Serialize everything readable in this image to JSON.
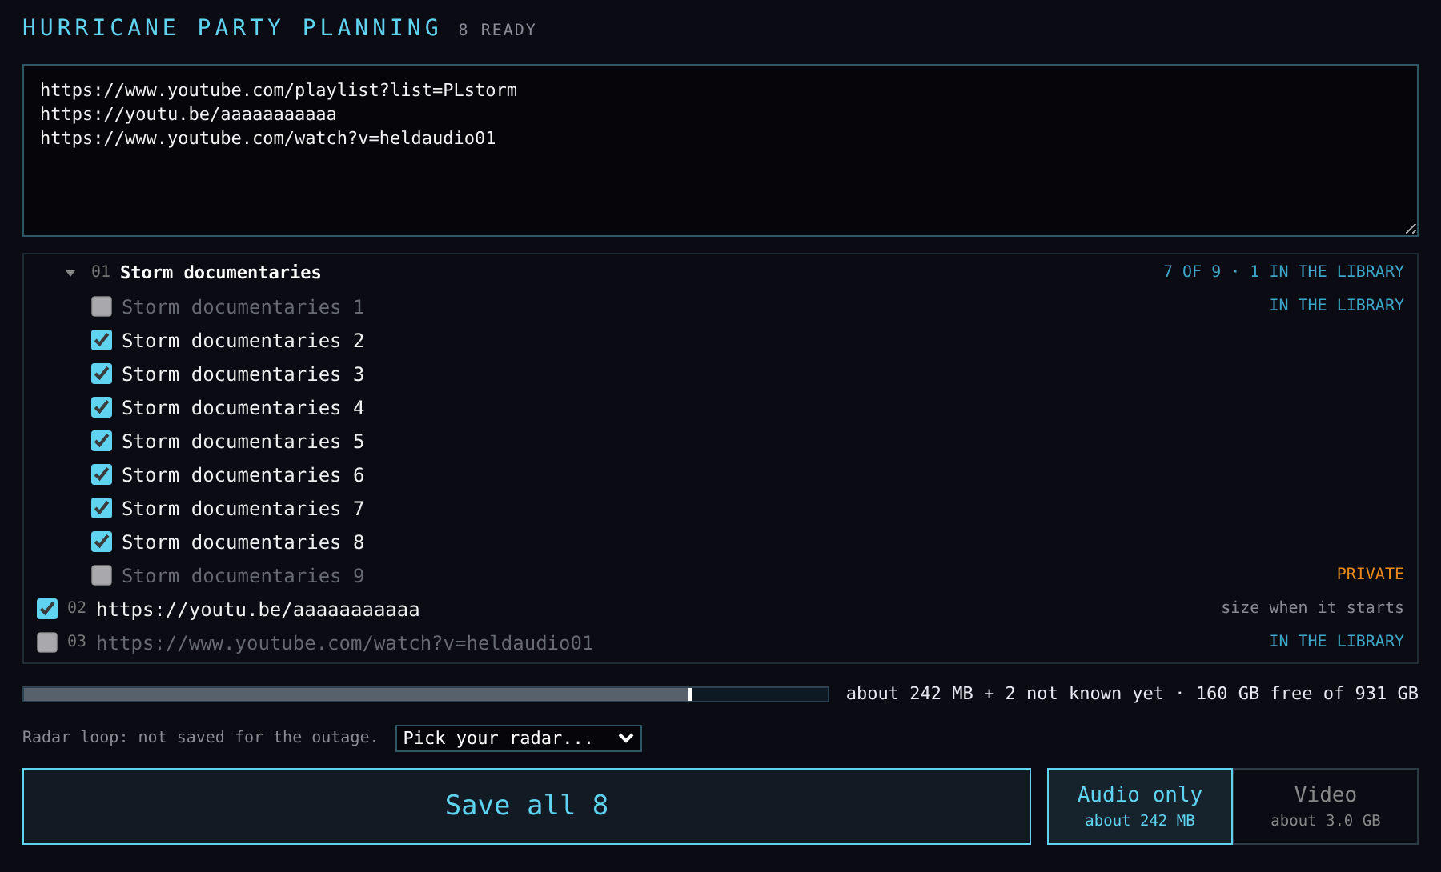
{
  "header": {
    "title": "HURRICANE PARTY PLANNING",
    "count": "8 READY"
  },
  "links_box": {
    "value": "https://www.youtube.com/playlist?list=PLstorm\nhttps://youtu.be/aaaaaaaaaaa\nhttps://www.youtube.com/watch?v=heldaudio01"
  },
  "items": [
    {
      "kind": "playlist",
      "number": "01",
      "title": "Storm documentaries",
      "expanded": true,
      "note": {
        "text": "7 OF 9 · 1 IN THE LIBRARY",
        "color": "#3fa6c9"
      },
      "children": [
        {
          "title": "Storm documentaries 1",
          "checked": false,
          "disabled": true,
          "note": {
            "text": "IN THE LIBRARY",
            "color": "#3fa6c9"
          }
        },
        {
          "title": "Storm documentaries 2",
          "checked": true,
          "disabled": false
        },
        {
          "title": "Storm documentaries 3",
          "checked": true,
          "disabled": false
        },
        {
          "title": "Storm documentaries 4",
          "checked": true,
          "disabled": false
        },
        {
          "title": "Storm documentaries 5",
          "checked": true,
          "disabled": false
        },
        {
          "title": "Storm documentaries 6",
          "checked": true,
          "disabled": false
        },
        {
          "title": "Storm documentaries 7",
          "checked": true,
          "disabled": false
        },
        {
          "title": "Storm documentaries 8",
          "checked": true,
          "disabled": false
        },
        {
          "title": "Storm documentaries 9",
          "checked": false,
          "disabled": true,
          "note": {
            "text": "PRIVATE",
            "color": "#e8881a"
          }
        }
      ]
    },
    {
      "kind": "video",
      "number": "02",
      "title": "https://youtu.be/aaaaaaaaaaa",
      "checked": true,
      "disabled": false,
      "note": {
        "text": "size when it starts",
        "color": "#8a8a92"
      }
    },
    {
      "kind": "video",
      "number": "03",
      "title": "https://www.youtube.com/watch?v=heldaudio01",
      "checked": false,
      "disabled": true,
      "note": {
        "text": "IN THE LIBRARY",
        "color": "#3fa6c9"
      }
    }
  ],
  "storage": {
    "level": 0.83,
    "reading": "about 242 MB + 2 not known yet · 160 GB free of 931 GB"
  },
  "radar": {
    "label": "Radar loop: not saved for the outage.",
    "placeholder": "Pick your radar..."
  },
  "save_button": "Save all 8",
  "formats": [
    {
      "label": "Audio only",
      "size": "about 242 MB",
      "selected": true
    },
    {
      "label": "Video",
      "size": "about 3.0 GB",
      "selected": false
    }
  ]
}
